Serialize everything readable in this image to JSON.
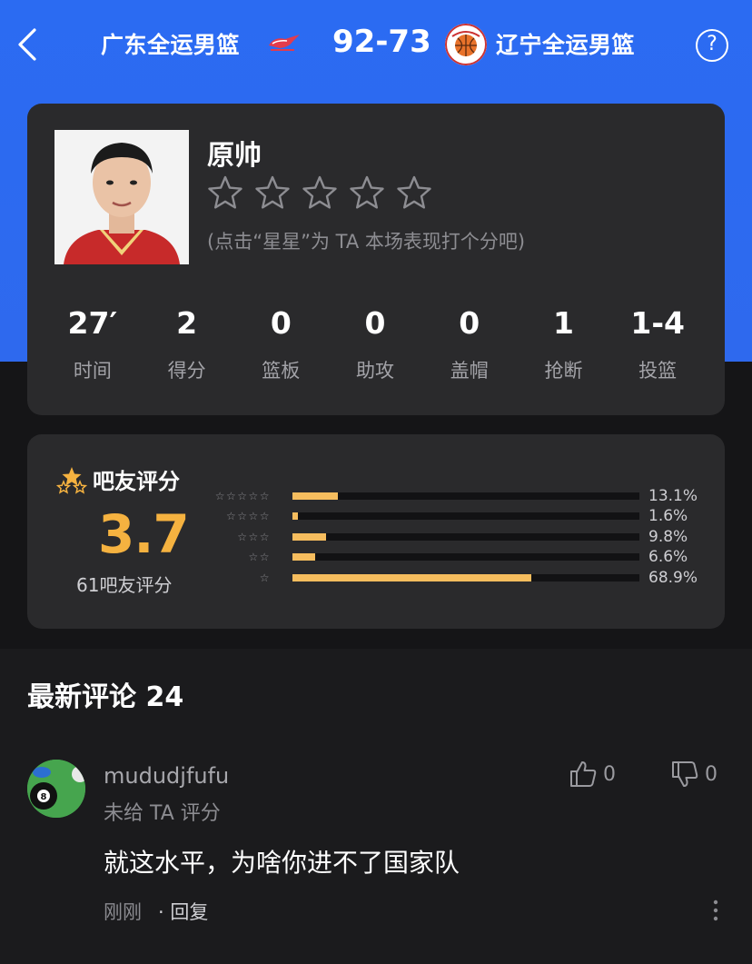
{
  "header": {
    "home_team": "广东全运男篮",
    "score": "92-73",
    "away_team": "辽宁全运男篮"
  },
  "player": {
    "name": "原帅",
    "rate_hint": "(点击“星星”为 TA 本场表现打个分吧)",
    "stats": [
      {
        "value": "27′",
        "label": "时间"
      },
      {
        "value": "2",
        "label": "得分"
      },
      {
        "value": "0",
        "label": "篮板"
      },
      {
        "value": "0",
        "label": "助攻"
      },
      {
        "value": "0",
        "label": "盖帽"
      },
      {
        "value": "1",
        "label": "抢断"
      },
      {
        "value": "1-4",
        "label": "投篮"
      }
    ]
  },
  "rating": {
    "title": "吧友评分",
    "score": "3.7",
    "count": "61吧友评分",
    "distribution": [
      {
        "stars": "☆☆☆☆☆",
        "percent_text": "13.1%",
        "percent": 13.1
      },
      {
        "stars": "☆☆☆☆",
        "percent_text": "1.6%",
        "percent": 1.6
      },
      {
        "stars": "☆☆☆",
        "percent_text": "9.8%",
        "percent": 9.8
      },
      {
        "stars": "☆☆",
        "percent_text": "6.6%",
        "percent": 6.6
      },
      {
        "stars": "☆",
        "percent_text": "68.9%",
        "percent": 68.9
      }
    ],
    "accent_color": "#f5b240",
    "bar_color": "#f6bd5e"
  },
  "comments": {
    "title": "最新评论 24",
    "items": [
      {
        "username": "mududjfufu",
        "user_rating": "未给 TA 评分",
        "likes": "0",
        "dislikes": "0",
        "text": "就这水平，为啥你进不了国家队",
        "time": "刚刚",
        "reply": "· 回复"
      }
    ]
  },
  "colors": {
    "header_blue": "#2b6bf2",
    "card_bg": "#2a2a2c",
    "page_bg": "#1b1b1d"
  }
}
